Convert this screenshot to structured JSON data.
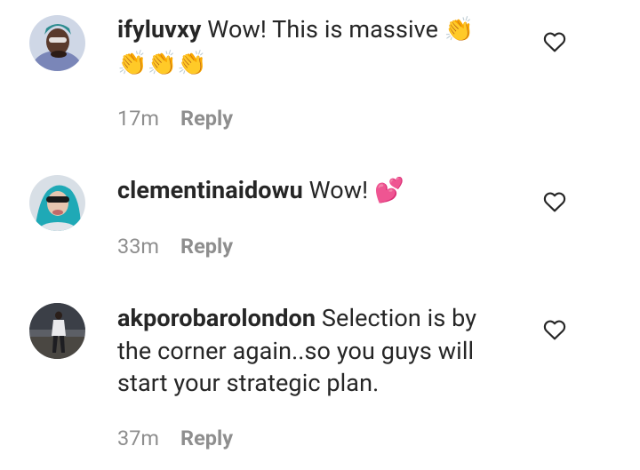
{
  "comments": [
    {
      "username": "ifyluvxy",
      "text": "Wow! This is massive",
      "emoji_line1": "👏",
      "emoji_line2": "👏👏👏",
      "time": "17m",
      "reply_label": "Reply"
    },
    {
      "username": "clementinaidowu",
      "text": "Wow!",
      "emoji_line1": "💕",
      "time": "33m",
      "reply_label": "Reply"
    },
    {
      "username": "akporobarolondon",
      "text": "Selection is by the corner again..so you guys will start your strategic plan.",
      "time": "37m",
      "reply_label": "Reply"
    }
  ],
  "icons": {
    "like": "heart-outline-icon"
  },
  "colors": {
    "primary_text": "#262626",
    "secondary_text": "#8e8e8e",
    "background": "#ffffff"
  }
}
